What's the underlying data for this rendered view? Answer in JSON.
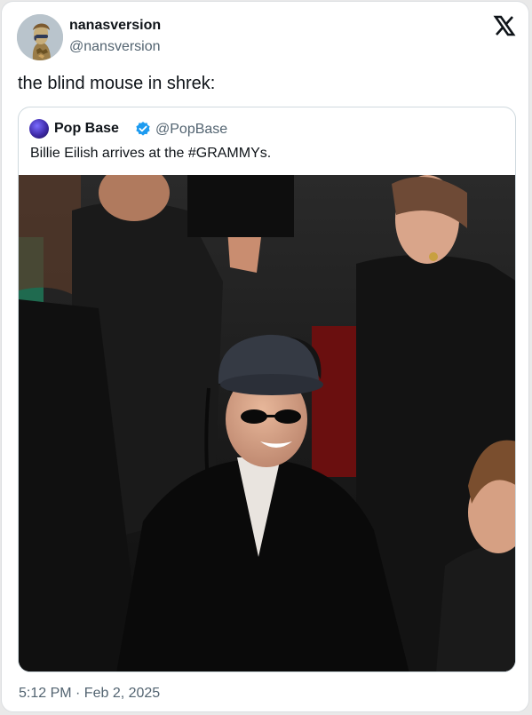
{
  "author": {
    "display_name": "nanasversion",
    "handle": "@nansversion"
  },
  "tweet": {
    "text": "the blind mouse in shrek:",
    "timestamp": "5:12 PM · Feb 2, 2025"
  },
  "quoted_tweet": {
    "display_name": "Pop Base",
    "handle": "@PopBase",
    "verified": true,
    "text": "Billie Eilish arrives at the #GRAMMYs."
  },
  "icons": {
    "platform": "x-logo-icon",
    "verified": "verified-badge-icon"
  },
  "colors": {
    "text_primary": "#0f1419",
    "text_secondary": "#536471",
    "verified_blue": "#1d9bf0",
    "border": "#cfd9de"
  }
}
